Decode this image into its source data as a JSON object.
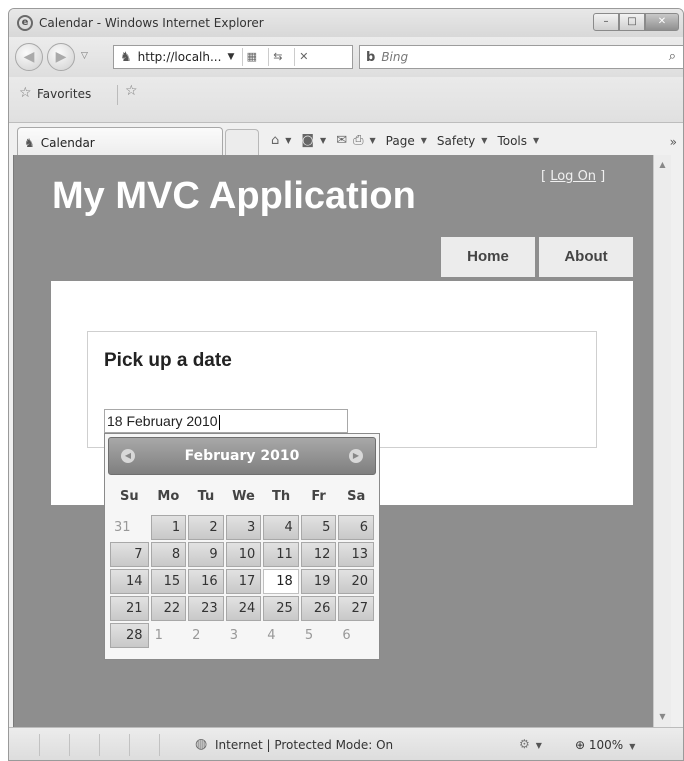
{
  "window": {
    "title": "Calendar - Windows Internet Explorer",
    "minimize": "–",
    "maximize": "□",
    "close": "✕"
  },
  "address_bar": {
    "back_icon": "back-arrow-icon",
    "forward_icon": "forward-arrow-icon",
    "url": "http://localh...",
    "search_placeholder": "Bing"
  },
  "favorites_bar": {
    "favorites_label": "Favorites",
    "tab_label": "Calendar",
    "menus": [
      "Page",
      "Safety",
      "Tools"
    ]
  },
  "page": {
    "site_title": "My MVC Application",
    "logon_open": "[ ",
    "logon_link": "Log On",
    "logon_close": " ]",
    "nav": {
      "home": "Home",
      "about": "About"
    },
    "section_title": "Pick up a date",
    "date_value": "18 February 2010"
  },
  "datepicker": {
    "month_title": "February 2010",
    "day_headers": [
      "Su",
      "Mo",
      "Tu",
      "We",
      "Th",
      "Fr",
      "Sa"
    ],
    "weeks": [
      [
        {
          "d": "31",
          "t": "other"
        },
        {
          "d": "1",
          "t": "cur"
        },
        {
          "d": "2",
          "t": "cur"
        },
        {
          "d": "3",
          "t": "cur"
        },
        {
          "d": "4",
          "t": "cur"
        },
        {
          "d": "5",
          "t": "cur"
        },
        {
          "d": "6",
          "t": "cur"
        }
      ],
      [
        {
          "d": "7",
          "t": "cur"
        },
        {
          "d": "8",
          "t": "cur"
        },
        {
          "d": "9",
          "t": "cur"
        },
        {
          "d": "10",
          "t": "cur"
        },
        {
          "d": "11",
          "t": "cur"
        },
        {
          "d": "12",
          "t": "cur"
        },
        {
          "d": "13",
          "t": "cur"
        }
      ],
      [
        {
          "d": "14",
          "t": "cur"
        },
        {
          "d": "15",
          "t": "cur"
        },
        {
          "d": "16",
          "t": "cur"
        },
        {
          "d": "17",
          "t": "cur"
        },
        {
          "d": "18",
          "t": "today"
        },
        {
          "d": "19",
          "t": "cur"
        },
        {
          "d": "20",
          "t": "cur"
        }
      ],
      [
        {
          "d": "21",
          "t": "cur"
        },
        {
          "d": "22",
          "t": "cur"
        },
        {
          "d": "23",
          "t": "cur"
        },
        {
          "d": "24",
          "t": "cur"
        },
        {
          "d": "25",
          "t": "cur"
        },
        {
          "d": "26",
          "t": "cur"
        },
        {
          "d": "27",
          "t": "cur"
        }
      ],
      [
        {
          "d": "28",
          "t": "cur"
        },
        {
          "d": "1",
          "t": "other"
        },
        {
          "d": "2",
          "t": "other"
        },
        {
          "d": "3",
          "t": "other"
        },
        {
          "d": "4",
          "t": "other"
        },
        {
          "d": "5",
          "t": "other"
        },
        {
          "d": "6",
          "t": "other"
        }
      ]
    ]
  },
  "status_bar": {
    "zone_text": "Internet | Protected Mode: On",
    "zoom": "100%"
  }
}
